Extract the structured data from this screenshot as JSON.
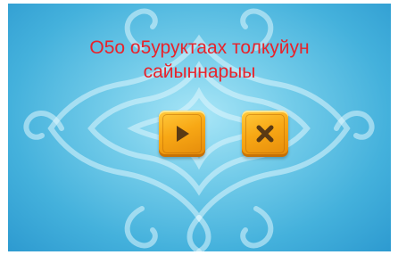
{
  "game": {
    "title_line1": "О5о о5уруктаах толкуйун",
    "title_line2": "сайыннарыы",
    "buttons": {
      "play_icon": "play-icon",
      "close_icon": "close-icon"
    }
  },
  "colors": {
    "title": "#e8232b",
    "button": "#f8a815",
    "icon": "#5a3a14",
    "background": "#5bbfe3"
  }
}
